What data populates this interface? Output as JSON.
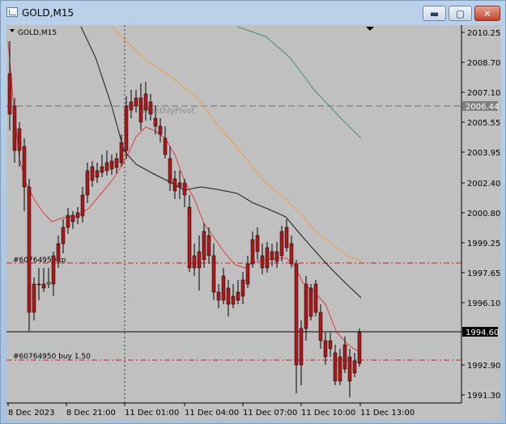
{
  "window": {
    "title": "GOLD,M15",
    "buttons": {
      "minimize": "▬",
      "maximize": "▢",
      "close": "✕"
    }
  },
  "chart": {
    "symbol_label": "GOLD,M15",
    "price_axis": [
      "2010.25",
      "2008.70",
      "2007.10",
      "2005.55",
      "2003.95",
      "2002.40",
      "2000.80",
      "1999.25",
      "1997.65",
      "1996.10",
      "1992.90",
      "1991.30"
    ],
    "time_axis": [
      "8 Dec 2023",
      "8 Dec 21:00",
      "11 Dec 01:00",
      "11 Dec 04:00",
      "11 Dec 07:00",
      "11 Dec 10:00",
      "11 Dec 13:00"
    ],
    "current_price_tag": "1994.60",
    "pivot_price_tag": "2006.44",
    "pivot_label": "MonthlyPivot",
    "order_labels": {
      "tp": "#60764950 tp",
      "buy": "#60764950 buy 1.50"
    },
    "colors": {
      "background": "#c0c0c0",
      "bull": "#2ecc2e",
      "bear": "#b01818",
      "ma_red": "#e33a3a",
      "ma_black": "#1a1a1a",
      "ma_orange": "#f0a040",
      "ma_teal": "#4a8a80",
      "order_line": "#d02020"
    }
  }
}
